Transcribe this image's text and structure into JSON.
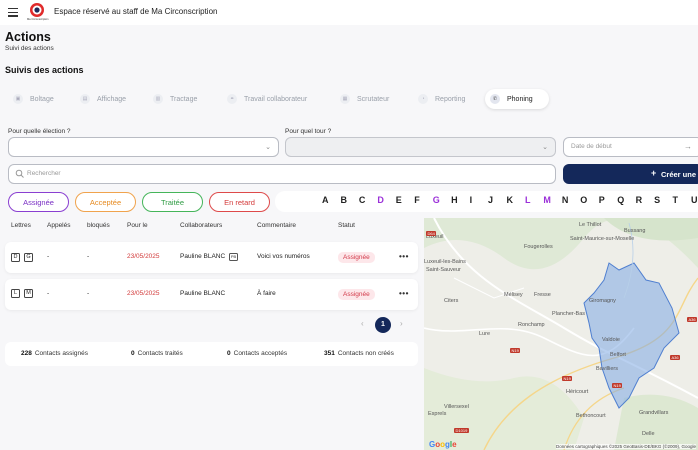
{
  "header": {
    "logo_text": "Ma Circonscription",
    "title": "Espace réservé au staff de Ma Circonscription"
  },
  "page": {
    "title": "Actions",
    "subtitle": "Suivi des actions",
    "section_title": "Suivis des actions"
  },
  "tabs": [
    {
      "label": "Boltage",
      "icon": "box-icon"
    },
    {
      "label": "Affichage",
      "icon": "poster-icon"
    },
    {
      "label": "Tractage",
      "icon": "flyer-icon"
    },
    {
      "label": "Travail collaborateur",
      "icon": "handshake-icon"
    },
    {
      "label": "Scrutateur",
      "icon": "ballot-icon"
    },
    {
      "label": "Reporting",
      "icon": "report-icon"
    },
    {
      "label": "Phoning",
      "icon": "phone-icon",
      "active": true
    }
  ],
  "filters": {
    "election_label": "Pour quelle élection ?",
    "tour_label": "Pour quel tour ?",
    "date_placeholder": "Date de début",
    "search_placeholder": "Rechercher",
    "create_label": "Créer une a"
  },
  "status_chips": {
    "assignee": "Assignée",
    "acceptee": "Acceptée",
    "traitee": "Traitée",
    "retard": "En retard"
  },
  "alphabet": {
    "letters": [
      "A",
      "B",
      "C",
      "D",
      "E",
      "F",
      "G",
      "H",
      "I",
      "J",
      "K",
      "L",
      "M",
      "N",
      "O",
      "P",
      "Q",
      "R",
      "S",
      "T",
      "U"
    ],
    "highlighted": [
      "D",
      "G",
      "L",
      "M"
    ],
    "highlight_color": "#9b30d9"
  },
  "table": {
    "headers": {
      "lettres": "Lettres",
      "appeles": "Appelés",
      "bloques": "bloqués",
      "pour_le": "Pour le",
      "collaborateurs": "Collaborateurs",
      "commentaire": "Commentaire",
      "statut": "Statut"
    },
    "rows": [
      {
        "letters": [
          "D",
          "G"
        ],
        "appeles": "-",
        "bloques": "-",
        "date": "23/05/2025",
        "collaborateur": "Pauline BLANC",
        "initials": "PB",
        "commentaire": "Voici vos numéros",
        "statut": "Assignée",
        "more": "•••"
      },
      {
        "letters": [
          "L",
          "M"
        ],
        "appeles": "-",
        "bloques": "-",
        "date": "23/05/2025",
        "collaborateur": "Pauline BLANC",
        "initials": "",
        "commentaire": "À faire",
        "statut": "Assignée",
        "more": "•••"
      }
    ]
  },
  "pagination": {
    "prev": "‹",
    "current": "1",
    "next": "›"
  },
  "stats": [
    {
      "value": "228",
      "label": "Contacts assignés"
    },
    {
      "value": "0",
      "label": "Contacts traités"
    },
    {
      "value": "0",
      "label": "Contacts acceptés"
    },
    {
      "value": "351",
      "label": "Contacts non créés"
    }
  ],
  "map": {
    "places": [
      "Luxeuil",
      "Le Thillot",
      "Bussang",
      "Saint-Maurice-sur-Moselle",
      "Fougerolles",
      "Luxeuil-les-Bains",
      "Saint-Sauveur",
      "Citers",
      "Mélisey",
      "Fresse",
      "Giromagny",
      "Plancher-Bas",
      "Ronchamp",
      "Lure",
      "Valdoie",
      "Belfort",
      "Bavilliers",
      "Héricourt",
      "Bethoncourt",
      "Villersexel",
      "Esprels",
      "Grandvillars",
      "Delle"
    ],
    "road_badges": [
      "D64",
      "N19",
      "N19",
      "A36",
      "A36",
      "N19",
      "D1019"
    ],
    "copyright": "Données cartographiques ©2025 GeoBasis-DE/BKG (©2009), Google",
    "google": "Google"
  }
}
